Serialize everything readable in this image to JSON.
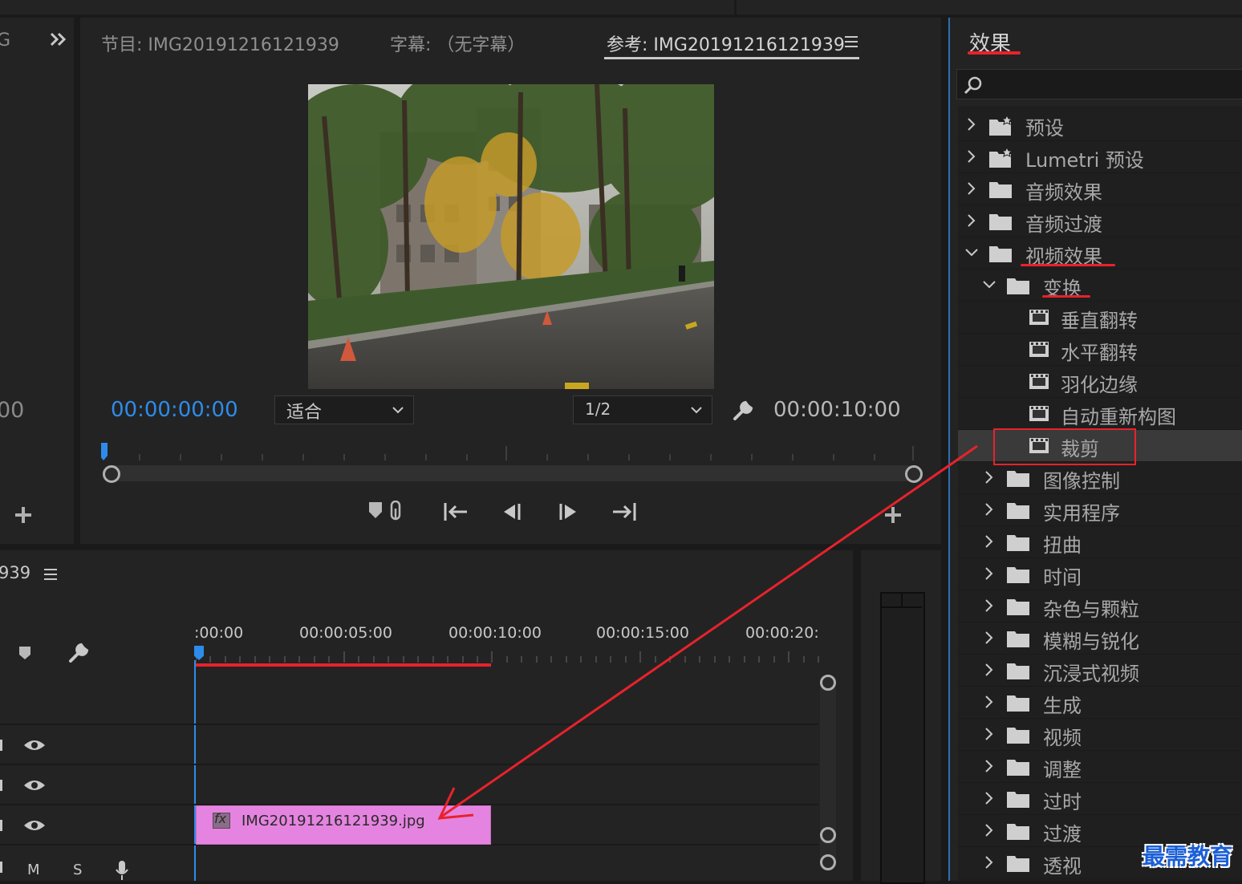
{
  "program_monitor": {
    "tabs": [
      {
        "label": "节目: IMG20191216121939"
      },
      {
        "label": "字幕: （无字幕）"
      },
      {
        "label": "参考: IMG20191216121939"
      }
    ],
    "left_panel_tab_fragment": "G",
    "left_timecode_fragment": "00",
    "current_timecode": "00:00:00:00",
    "fit_label": "适合",
    "resolution_label": "1/2",
    "duration_timecode": "00:00:10:00"
  },
  "timeline": {
    "sequence_name_fragment": "939",
    "ruler_labels": [
      ":00:00",
      "00:00:05:00",
      "00:00:10:00",
      "00:00:15:00",
      "00:00:20:"
    ],
    "clip_name": "IMG20191216121939.jpg",
    "clip_color": "#e584e0",
    "fx_badge": "fx",
    "track_buttons": {
      "m": "M",
      "s": "S"
    }
  },
  "effects_panel": {
    "title": "效果",
    "search_placeholder": "",
    "items": [
      {
        "label": "预设",
        "icon": "preset-folder-icon",
        "expanded": false,
        "level": 0
      },
      {
        "label": "Lumetri 预设",
        "icon": "preset-folder-icon",
        "expanded": false,
        "level": 0
      },
      {
        "label": "音频效果",
        "icon": "folder-icon",
        "expanded": false,
        "level": 0
      },
      {
        "label": "音频过渡",
        "icon": "folder-icon",
        "expanded": false,
        "level": 0
      },
      {
        "label": "视频效果",
        "icon": "folder-icon",
        "expanded": true,
        "level": 0
      },
      {
        "label": "变换",
        "icon": "folder-icon",
        "expanded": true,
        "level": 1
      },
      {
        "label": "垂直翻转",
        "icon": "effect-icon",
        "level": 2
      },
      {
        "label": "水平翻转",
        "icon": "effect-icon",
        "level": 2
      },
      {
        "label": "羽化边缘",
        "icon": "effect-icon",
        "level": 2
      },
      {
        "label": "自动重新构图",
        "icon": "effect-icon",
        "level": 2
      },
      {
        "label": "裁剪",
        "icon": "effect-icon",
        "level": 2,
        "selected": true
      },
      {
        "label": "图像控制",
        "icon": "folder-icon",
        "expanded": false,
        "level": 1
      },
      {
        "label": "实用程序",
        "icon": "folder-icon",
        "expanded": false,
        "level": 1
      },
      {
        "label": "扭曲",
        "icon": "folder-icon",
        "expanded": false,
        "level": 1
      },
      {
        "label": "时间",
        "icon": "folder-icon",
        "expanded": false,
        "level": 1
      },
      {
        "label": "杂色与颗粒",
        "icon": "folder-icon",
        "expanded": false,
        "level": 1
      },
      {
        "label": "模糊与锐化",
        "icon": "folder-icon",
        "expanded": false,
        "level": 1
      },
      {
        "label": "沉浸式视频",
        "icon": "folder-icon",
        "expanded": false,
        "level": 1
      },
      {
        "label": "生成",
        "icon": "folder-icon",
        "expanded": false,
        "level": 1
      },
      {
        "label": "视频",
        "icon": "folder-icon",
        "expanded": false,
        "level": 1
      },
      {
        "label": "调整",
        "icon": "folder-icon",
        "expanded": false,
        "level": 1
      },
      {
        "label": "过时",
        "icon": "folder-icon",
        "expanded": false,
        "level": 1
      },
      {
        "label": "过渡",
        "icon": "folder-icon",
        "expanded": false,
        "level": 1
      },
      {
        "label": "透视",
        "icon": "folder-icon",
        "expanded": false,
        "level": 1
      }
    ]
  },
  "watermark": {
    "text": "最需教育"
  },
  "colors": {
    "accent_blue": "#2d8ceb",
    "annotation_red": "#e8222b",
    "panel_bg": "#232323",
    "selected_row": "#3a3a3a"
  }
}
